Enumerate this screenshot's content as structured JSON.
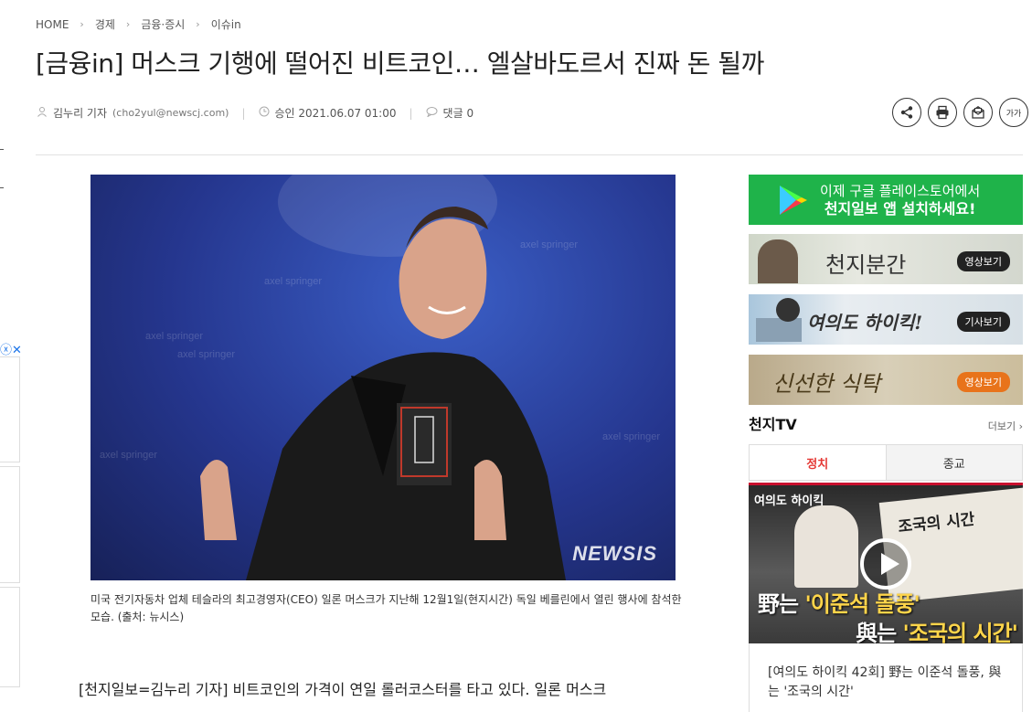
{
  "breadcrumb": [
    "HOME",
    "경제",
    "금융·증시",
    "이슈in"
  ],
  "article": {
    "title": "[금융in] 머스크 기행에 떨어진 비트코인… 엘살바도르서 진짜 돈 될까",
    "author": "김누리 기자",
    "email": "(cho2yul@newscj.com)",
    "approved": "승인 2021.06.07 01:00",
    "comments": "댓글 0",
    "photo_watermark": "NEWSIS",
    "photo_caption": "미국 전기자동차 업체 테슬라의 최고경영자(CEO) 일론 머스크가 지난해 12월1일(현지시간) 독일 베를린에서 열린 행사에 참석한 모습. (출처: 뉴시스)",
    "body_first_line": "[천지일보=김누리 기자] 비트코인의 가격이 연일 롤러코스터를 타고 있다. 일론 머스크"
  },
  "tools": {
    "share_icon": "share-icon",
    "print_icon": "print-icon",
    "email_icon": "email-icon",
    "font_size_label": "가가"
  },
  "sidebar": {
    "play_banner": {
      "line1": "이제 구글 플레이스토어에서",
      "line2": "천지일보 앱 설치하세요!"
    },
    "banners": [
      {
        "title": "천지분간",
        "badge": "영상보기"
      },
      {
        "title": "여의도 하이킥!",
        "badge": "기사보기"
      },
      {
        "title": "신선한 식탁",
        "badge": "영상보기"
      }
    ],
    "tv": {
      "title": "천지TV",
      "more": "더보기 ›",
      "tabs": [
        "정치",
        "종교"
      ],
      "thumb": {
        "brand": "여의도 하이킥",
        "book_title": "조국의 시간",
        "line1_a": "野는",
        "line1_b": "'이준석 돌풍'",
        "line2_a": "與는",
        "line2_b": "'조국의 시간'"
      },
      "caption": "[여의도 하이킥 42회] 野는 이준석 돌풍, 與는 '조국의 시간'"
    }
  },
  "colors": {
    "play_green": "#1fb34a",
    "active_tab": "#e53935",
    "badge_orange": "#e8731b"
  }
}
